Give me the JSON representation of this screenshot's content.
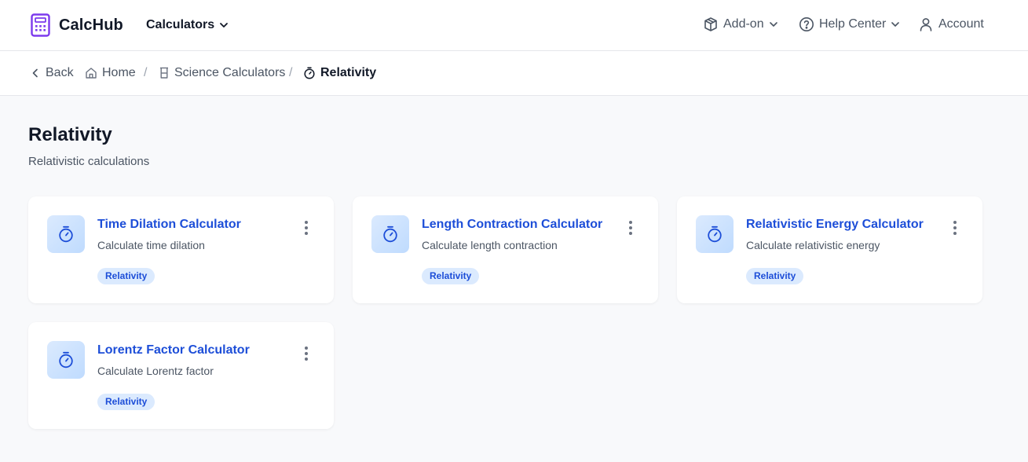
{
  "header": {
    "brand": "CalcHub",
    "calculators_label": "Calculators",
    "addon_label": "Add-on",
    "help_label": "Help Center",
    "account_label": "Account"
  },
  "breadcrumb": {
    "back": "Back",
    "home": "Home",
    "science": "Science Calculators",
    "current": "Relativity",
    "separator": "/"
  },
  "page": {
    "title": "Relativity",
    "subtitle": "Relativistic calculations"
  },
  "cards": [
    {
      "title": "Time Dilation Calculator",
      "desc": "Calculate time dilation",
      "tag": "Relativity",
      "icon": "stopwatch-icon"
    },
    {
      "title": "Length Contraction Calculator",
      "desc": "Calculate length contraction",
      "tag": "Relativity",
      "icon": "stopwatch-icon"
    },
    {
      "title": "Relativistic Energy Calculator",
      "desc": "Calculate relativistic energy",
      "tag": "Relativity",
      "icon": "stopwatch-icon"
    },
    {
      "title": "Lorentz Factor Calculator",
      "desc": "Calculate Lorentz factor",
      "tag": "Relativity",
      "icon": "stopwatch-icon"
    }
  ],
  "colors": {
    "brand_purple": "#7c3aed",
    "link_blue": "#1d4ed8",
    "tag_bg": "#dbeafe"
  }
}
